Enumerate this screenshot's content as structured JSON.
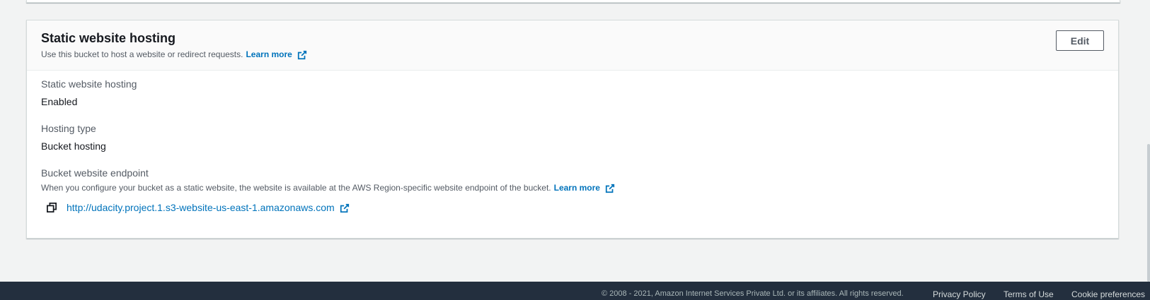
{
  "panel": {
    "title": "Static website hosting",
    "description": "Use this bucket to host a website or redirect requests.",
    "learn_more": "Learn more",
    "edit_label": "Edit"
  },
  "fields": {
    "hosting_label": "Static website hosting",
    "hosting_value": "Enabled",
    "type_label": "Hosting type",
    "type_value": "Bucket hosting",
    "endpoint_label": "Bucket website endpoint",
    "endpoint_desc": "When you configure your bucket as a static website, the website is available at the AWS Region-specific website endpoint of the bucket.",
    "endpoint_learn_more": "Learn more",
    "endpoint_url": "http://udacity.project.1.s3-website-us-east-1.amazonaws.com"
  },
  "footer": {
    "copyright": "© 2008 - 2021, Amazon Internet Services Private Ltd. or its affiliates. All rights reserved.",
    "privacy": "Privacy Policy",
    "terms": "Terms of Use",
    "cookies": "Cookie preferences"
  },
  "colors": {
    "link": "#0073bb",
    "footer_bg": "#232f3e",
    "page_bg": "#f2f3f3"
  },
  "icons": [
    "external-link-icon",
    "copy-icon"
  ]
}
